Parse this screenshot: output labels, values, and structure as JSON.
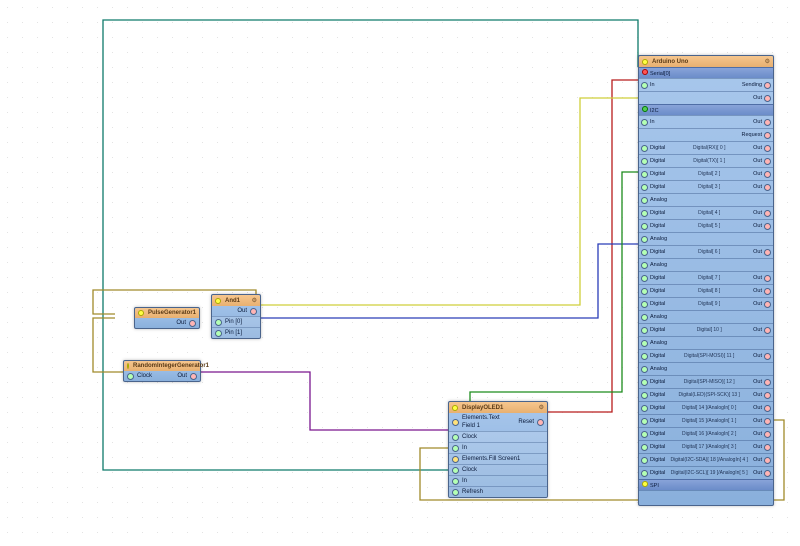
{
  "nodes": {
    "pulse": {
      "title": "PulseGenerator1",
      "out": "Out"
    },
    "randint": {
      "title": "RandomIntegerGenerator1",
      "clk": "Clock",
      "out": "Out"
    },
    "and": {
      "title": "And1",
      "pin0": "Pin [0]",
      "pin1": "Pin [1]",
      "out": "Out"
    },
    "display": {
      "title": "DisplayOLED1",
      "row1_l": "Elements.Text Field 1",
      "row1_r": "Reset",
      "row2": "Clock",
      "row3_in": "In",
      "row4": "Elements.Fill Screen1",
      "row5": "Clock",
      "row6": "In",
      "row7": "Refresh"
    },
    "arduino": {
      "title": "Arduino Uno",
      "serial": "Serial[0]",
      "in": "In",
      "sending": "Sending",
      "out": "Out",
      "i2c": "I2C",
      "i2c_in": "In",
      "i2c_out": "Out",
      "request": "Request",
      "spi": "SPI",
      "pins": [
        {
          "l": "Digital",
          "m": "Digital(RX)[ 0 ]",
          "r": "Out"
        },
        {
          "l": "Digital",
          "m": "Digital(TX)[ 1 ]",
          "r": "Out"
        },
        {
          "l": "Digital",
          "m": "Digital[ 2 ]",
          "r": "Out"
        },
        {
          "l": "Digital",
          "m": "Digital[ 3 ]",
          "r": "Out"
        },
        {
          "l": "Analog",
          "m": "",
          "r": ""
        },
        {
          "l": "Digital",
          "m": "Digital[ 4 ]",
          "r": "Out"
        },
        {
          "l": "Digital",
          "m": "Digital[ 5 ]",
          "r": "Out"
        },
        {
          "l": "Analog",
          "m": "",
          "r": ""
        },
        {
          "l": "Digital",
          "m": "Digital[ 6 ]",
          "r": "Out"
        },
        {
          "l": "Analog",
          "m": "",
          "r": ""
        },
        {
          "l": "Digital",
          "m": "Digital[ 7 ]",
          "r": "Out"
        },
        {
          "l": "Digital",
          "m": "Digital[ 8 ]",
          "r": "Out"
        },
        {
          "l": "Digital",
          "m": "Digital[ 9 ]",
          "r": "Out"
        },
        {
          "l": "Analog",
          "m": "",
          "r": ""
        },
        {
          "l": "Digital",
          "m": "Digital[ 10 ]",
          "r": "Out"
        },
        {
          "l": "Analog",
          "m": "",
          "r": ""
        },
        {
          "l": "Digital",
          "m": "Digital(SPI-MOSI)[ 11 ]",
          "r": "Out"
        },
        {
          "l": "Analog",
          "m": "",
          "r": ""
        },
        {
          "l": "Digital",
          "m": "Digital(SPI-MISO)[ 12 ]",
          "r": "Out"
        },
        {
          "l": "Digital",
          "m": "Digital(LED)(SPI-SCK)[ 13 ]",
          "r": "Out"
        },
        {
          "l": "Digital",
          "m": "Digital[ 14 ]/AnalogIn[ 0 ]",
          "r": "Out"
        },
        {
          "l": "Digital",
          "m": "Digital[ 15 ]/AnalogIn[ 1 ]",
          "r": "Out"
        },
        {
          "l": "Digital",
          "m": "Digital[ 16 ]/AnalogIn[ 2 ]",
          "r": "Out"
        },
        {
          "l": "Digital",
          "m": "Digital[ 17 ]/AnalogIn[ 3 ]",
          "r": "Out"
        },
        {
          "l": "Digital",
          "m": "Digital(I2C-SDA)[ 18 ]/AnalogIn[ 4 ]",
          "r": "Out"
        },
        {
          "l": "Digital",
          "m": "Digital(I2C-SCL)[ 19 ]/AnalogIn[ 5 ]",
          "r": "Out"
        }
      ]
    }
  },
  "colors": {
    "teal": "#0e7a6a",
    "red": "#b81c1c",
    "mustard": "#a08a2a",
    "yellow": "#cfcf3a",
    "blue": "#2a3db8",
    "purple": "#7a168e",
    "green2": "#1c8c1c"
  }
}
